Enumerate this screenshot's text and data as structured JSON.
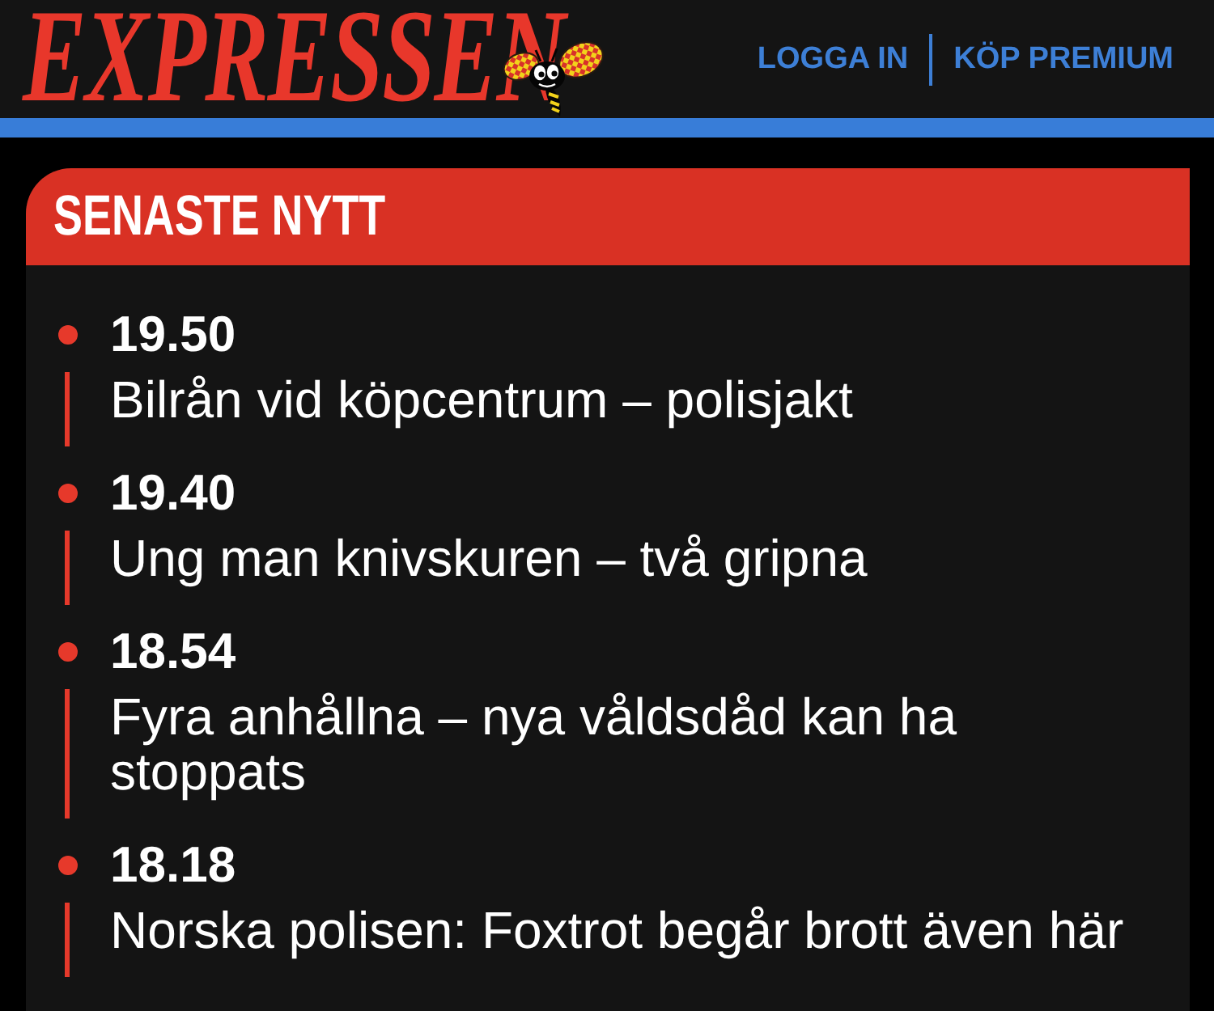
{
  "header": {
    "logo": "EXPRESSEN",
    "links": [
      {
        "label": "LOGGA IN"
      },
      {
        "label": "KÖP PREMIUM"
      }
    ]
  },
  "news_panel": {
    "title": "SENASTE NYTT",
    "items": [
      {
        "time": "19.50",
        "headline": "Bilrån vid köpcentrum – polisjakt"
      },
      {
        "time": "19.40",
        "headline": "Ung man knivskuren – två gripna"
      },
      {
        "time": "18.54",
        "headline": "Fyra anhållna – nya våldsdåd kan ha stoppats"
      },
      {
        "time": "18.18",
        "headline": "Norska polisen: Foxtrot begår brott även här"
      }
    ]
  }
}
